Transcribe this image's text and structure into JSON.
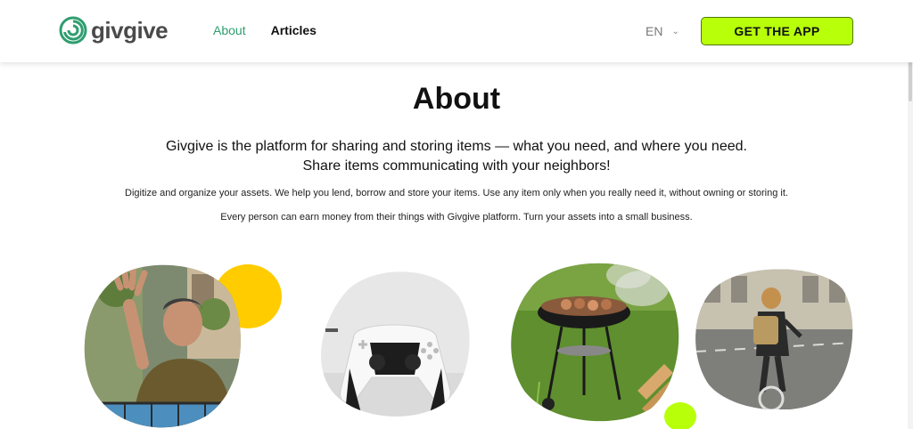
{
  "header": {
    "logo_text": "givgive",
    "nav": [
      {
        "label": "About"
      },
      {
        "label": "Articles"
      }
    ],
    "language": "EN",
    "cta_label": "GET THE APP"
  },
  "main": {
    "title": "About",
    "subtitle_line1": "Givgive is the platform for sharing and storing items — what you need, and where you need.",
    "subtitle_line2": "Share items communicating with your neighbors!",
    "paragraph1": "Digitize and organize your assets. We help you lend, borrow and store your items. Use any item only when you really need it, without owning or storing it.",
    "paragraph2": "Every person can earn money from their things with Givgive platform. Turn your assets into a small business."
  },
  "colors": {
    "brand_green": "#2f9e6f",
    "cta_lime": "#b8ff0a",
    "accent_yellow": "#ffcc00"
  }
}
